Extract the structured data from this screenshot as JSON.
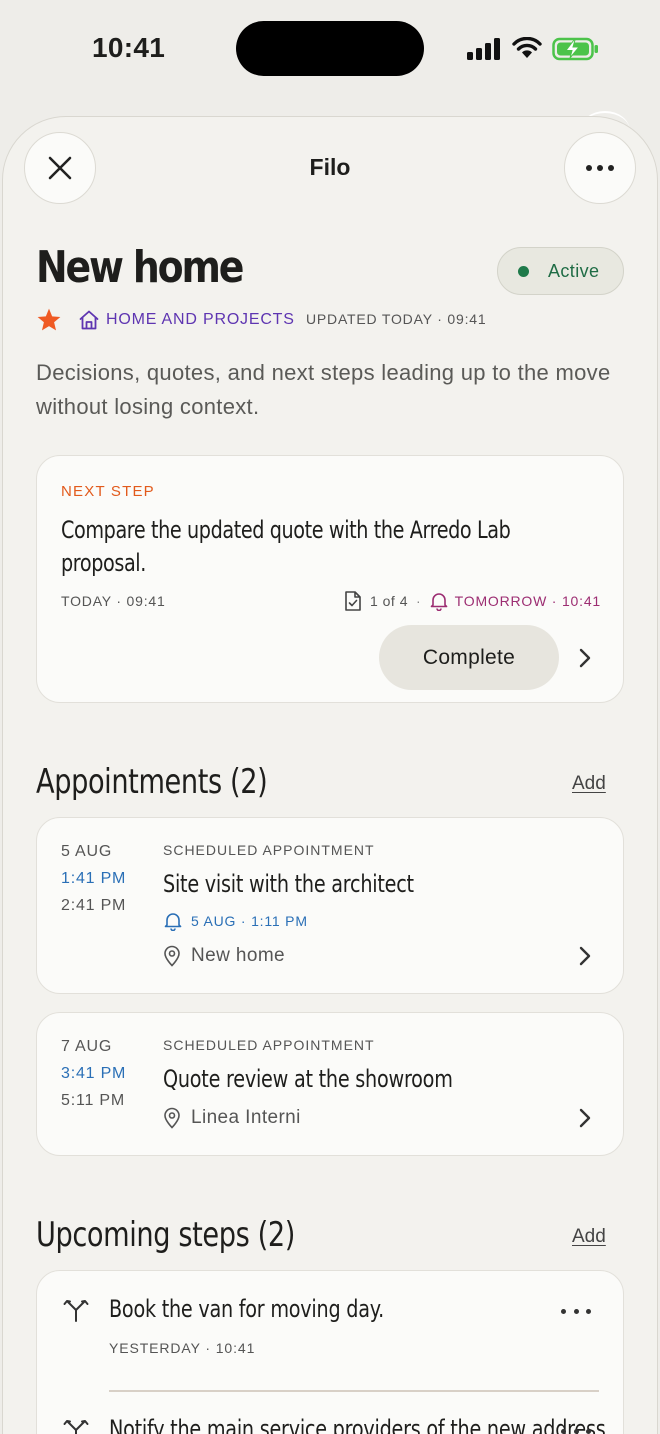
{
  "status_bar": {
    "time": "10:41"
  },
  "nav": {
    "title": "Filo"
  },
  "header": {
    "title": "New home",
    "status": "Active",
    "category": "HOME AND PROJECTS",
    "updated": "UPDATED TODAY · 09:41",
    "description": "Decisions, quotes, and next steps leading up to the move without losing context."
  },
  "next_step": {
    "label": "NEXT STEP",
    "text": "Compare the updated quote with the Arredo Lab proposal.",
    "date": "TODAY · 09:41",
    "progress": "1 of 4",
    "separator": "·",
    "reminder": "TOMORROW · 10:41",
    "complete_label": "Complete"
  },
  "appointments": {
    "title": "Appointments (2)",
    "add_label": "Add",
    "items": [
      {
        "day": "5 AUG",
        "start": "1:41 PM",
        "end": "2:41 PM",
        "type": "SCHEDULED APPOINTMENT",
        "title": "Site visit with the architect",
        "reminder": "5 AUG · 1:11 PM",
        "location": "New home"
      },
      {
        "day": "7 AUG",
        "start": "3:41 PM",
        "end": "5:11 PM",
        "type": "SCHEDULED APPOINTMENT",
        "title": "Quote review at the showroom",
        "location": "Linea Interni"
      }
    ]
  },
  "upcoming_steps": {
    "title": "Upcoming steps (2)",
    "add_label": "Add",
    "items": [
      {
        "title": "Book the van for moving day.",
        "date": "YESTERDAY · 10:41"
      },
      {
        "title": "Notify the main service providers of the new address."
      }
    ]
  },
  "colors": {
    "background": "#eeede9",
    "card": "#fbfbf9",
    "accent_orange": "#e25a1c",
    "category_purple": "#5e35b1",
    "status_green": "#1f7a4a",
    "reminder_magenta": "#9c2d72",
    "time_blue": "#2a6fb6"
  },
  "icons": {
    "close": "close-icon",
    "more": "more-horizontal-icon",
    "star": "star-icon",
    "house": "house-icon",
    "document": "document-check-icon",
    "bell": "bell-icon",
    "location": "location-pin-icon",
    "chevron": "chevron-right-icon",
    "branch": "branch-icon"
  }
}
